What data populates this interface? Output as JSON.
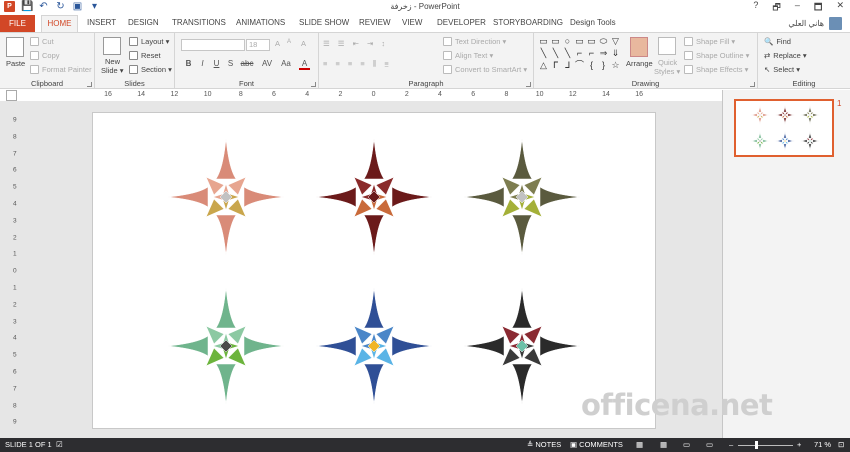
{
  "titlebar": {
    "title": "زخرفة - PowerPoint",
    "window_buttons": [
      "?",
      "🗗",
      "–",
      "🗖",
      "✕"
    ]
  },
  "tabs": [
    {
      "label": "FILE"
    },
    {
      "label": "HOME"
    },
    {
      "label": "INSERT"
    },
    {
      "label": "DESIGN"
    },
    {
      "label": "TRANSITIONS"
    },
    {
      "label": "ANIMATIONS"
    },
    {
      "label": "SLIDE SHOW"
    },
    {
      "label": "REVIEW"
    },
    {
      "label": "VIEW"
    },
    {
      "label": "DEVELOPER"
    },
    {
      "label": "STORYBOARDING"
    },
    {
      "label": "Design Tools"
    }
  ],
  "user": {
    "name": "هاني العلي"
  },
  "ribbon": {
    "clipboard": {
      "label": "Clipboard",
      "paste": "Paste",
      "cut": "Cut",
      "copy": "Copy",
      "format_painter": "Format Painter"
    },
    "slides": {
      "label": "Slides",
      "new_slide_1": "New",
      "new_slide_2": "Slide ▾",
      "layout": "Layout ▾",
      "reset": "Reset",
      "section": "Section ▾"
    },
    "font": {
      "label": "Font",
      "font_name": "",
      "font_size": "18",
      "buttons": [
        "B",
        "I",
        "U",
        "S",
        "abc",
        "AV",
        "Aa",
        "A"
      ],
      "grow": "A",
      "shrink": "A",
      "clear": "A"
    },
    "paragraph": {
      "label": "Paragraph",
      "text_direction": "Text Direction ▾",
      "align_text": "Align Text ▾",
      "convert_smartart": "Convert to SmartArt ▾"
    },
    "drawing": {
      "label": "Drawing",
      "arrange": "Arrange",
      "quick_styles_1": "Quick",
      "quick_styles_2": "Styles ▾",
      "shape_fill": "Shape Fill ▾",
      "shape_outline": "Shape Outline ▾",
      "shape_effects": "Shape Effects ▾",
      "shapes": [
        "▭",
        "▭",
        "○",
        "▭",
        "▭",
        "⬭",
        "▽",
        "╲",
        "╲",
        "╲",
        "⌐",
        "⌐",
        "⇒",
        "⇓",
        "△",
        "ᒥ",
        "ᒧ",
        "⌒",
        "{",
        "}",
        "☆"
      ]
    },
    "editing": {
      "label": "Editing",
      "find": "Find",
      "replace": "Replace ▾",
      "select": "Select ▾"
    }
  },
  "ruler": {
    "h_ticks": [
      "16",
      "14",
      "12",
      "10",
      "8",
      "6",
      "4",
      "2",
      "0",
      "2",
      "4",
      "6",
      "8",
      "10",
      "12",
      "14",
      "16"
    ],
    "v_ticks": [
      "9",
      "8",
      "7",
      "6",
      "5",
      "4",
      "3",
      "2",
      "1",
      "0",
      "1",
      "2",
      "3",
      "4",
      "5",
      "6",
      "7",
      "8",
      "9"
    ]
  },
  "slide": {
    "stars": [
      {
        "name": "salmon-star",
        "outer": "#d98b78",
        "inner_a": "#e7a58f",
        "inner_b": "#c9a64c",
        "center": "#c2c2c2"
      },
      {
        "name": "maroon-star",
        "outer": "#6b1a1a",
        "inner_a": "#8a2a2a",
        "inner_b": "#c96a3a",
        "center": "#6b1a1a"
      },
      {
        "name": "olive-star",
        "outer": "#5a5a3e",
        "inner_a": "#7d7d50",
        "inner_b": "#a4b038",
        "center": "#c2c2c2"
      },
      {
        "name": "green-star",
        "outer": "#6fb48c",
        "inner_a": "#8cc9a2",
        "inner_b": "#6cb43c",
        "center": "#4a4a4a"
      },
      {
        "name": "blue-star",
        "outer": "#2f4f96",
        "inner_a": "#4a86c8",
        "inner_b": "#5ab4e6",
        "center": "#f0b528"
      },
      {
        "name": "black-star",
        "outer": "#2a2a2a",
        "inner_a": "#8a2a32",
        "inner_b": "#3a3a3a",
        "center": "#6cc0a8"
      }
    ]
  },
  "thumbnail": {
    "number": "1"
  },
  "watermark": "officena.net",
  "status": {
    "slide_count": "SLIDE 1 OF 1",
    "notes": "NOTES",
    "comments": "COMMENTS",
    "zoom": "71 %",
    "zoom_level_percent": 71
  }
}
